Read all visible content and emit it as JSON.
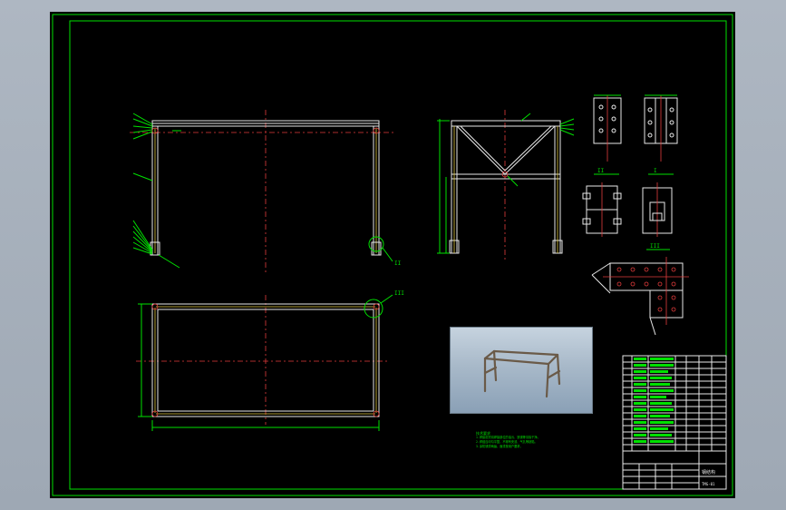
{
  "drawing": {
    "background_color": "#000000",
    "frame_color": "#00e000",
    "line_color": "#e8e8e8",
    "centerline_color": "#e23b3b",
    "viewport_color": "#a8b1bd"
  },
  "views": {
    "front_detail_label": "II",
    "plan_detail_label": "III",
    "detail_i_label": "I",
    "detail_ii_label": "II",
    "detail_iii_label": "III"
  },
  "render_preview": {
    "description_icon": "3d-frame-render"
  },
  "notes": {
    "title": "技术要求",
    "lines": [
      "1.焊接前须将焊接部位的油污、铁锈等清除干净。",
      "2.焊缝应均匀平整，不得有夹渣、气孔等缺陷。",
      "3.涂防锈漆两遍，面漆按用户要求。"
    ]
  },
  "title_block": {
    "drawing_title": "钢结构",
    "part_code": "TMG-01"
  }
}
